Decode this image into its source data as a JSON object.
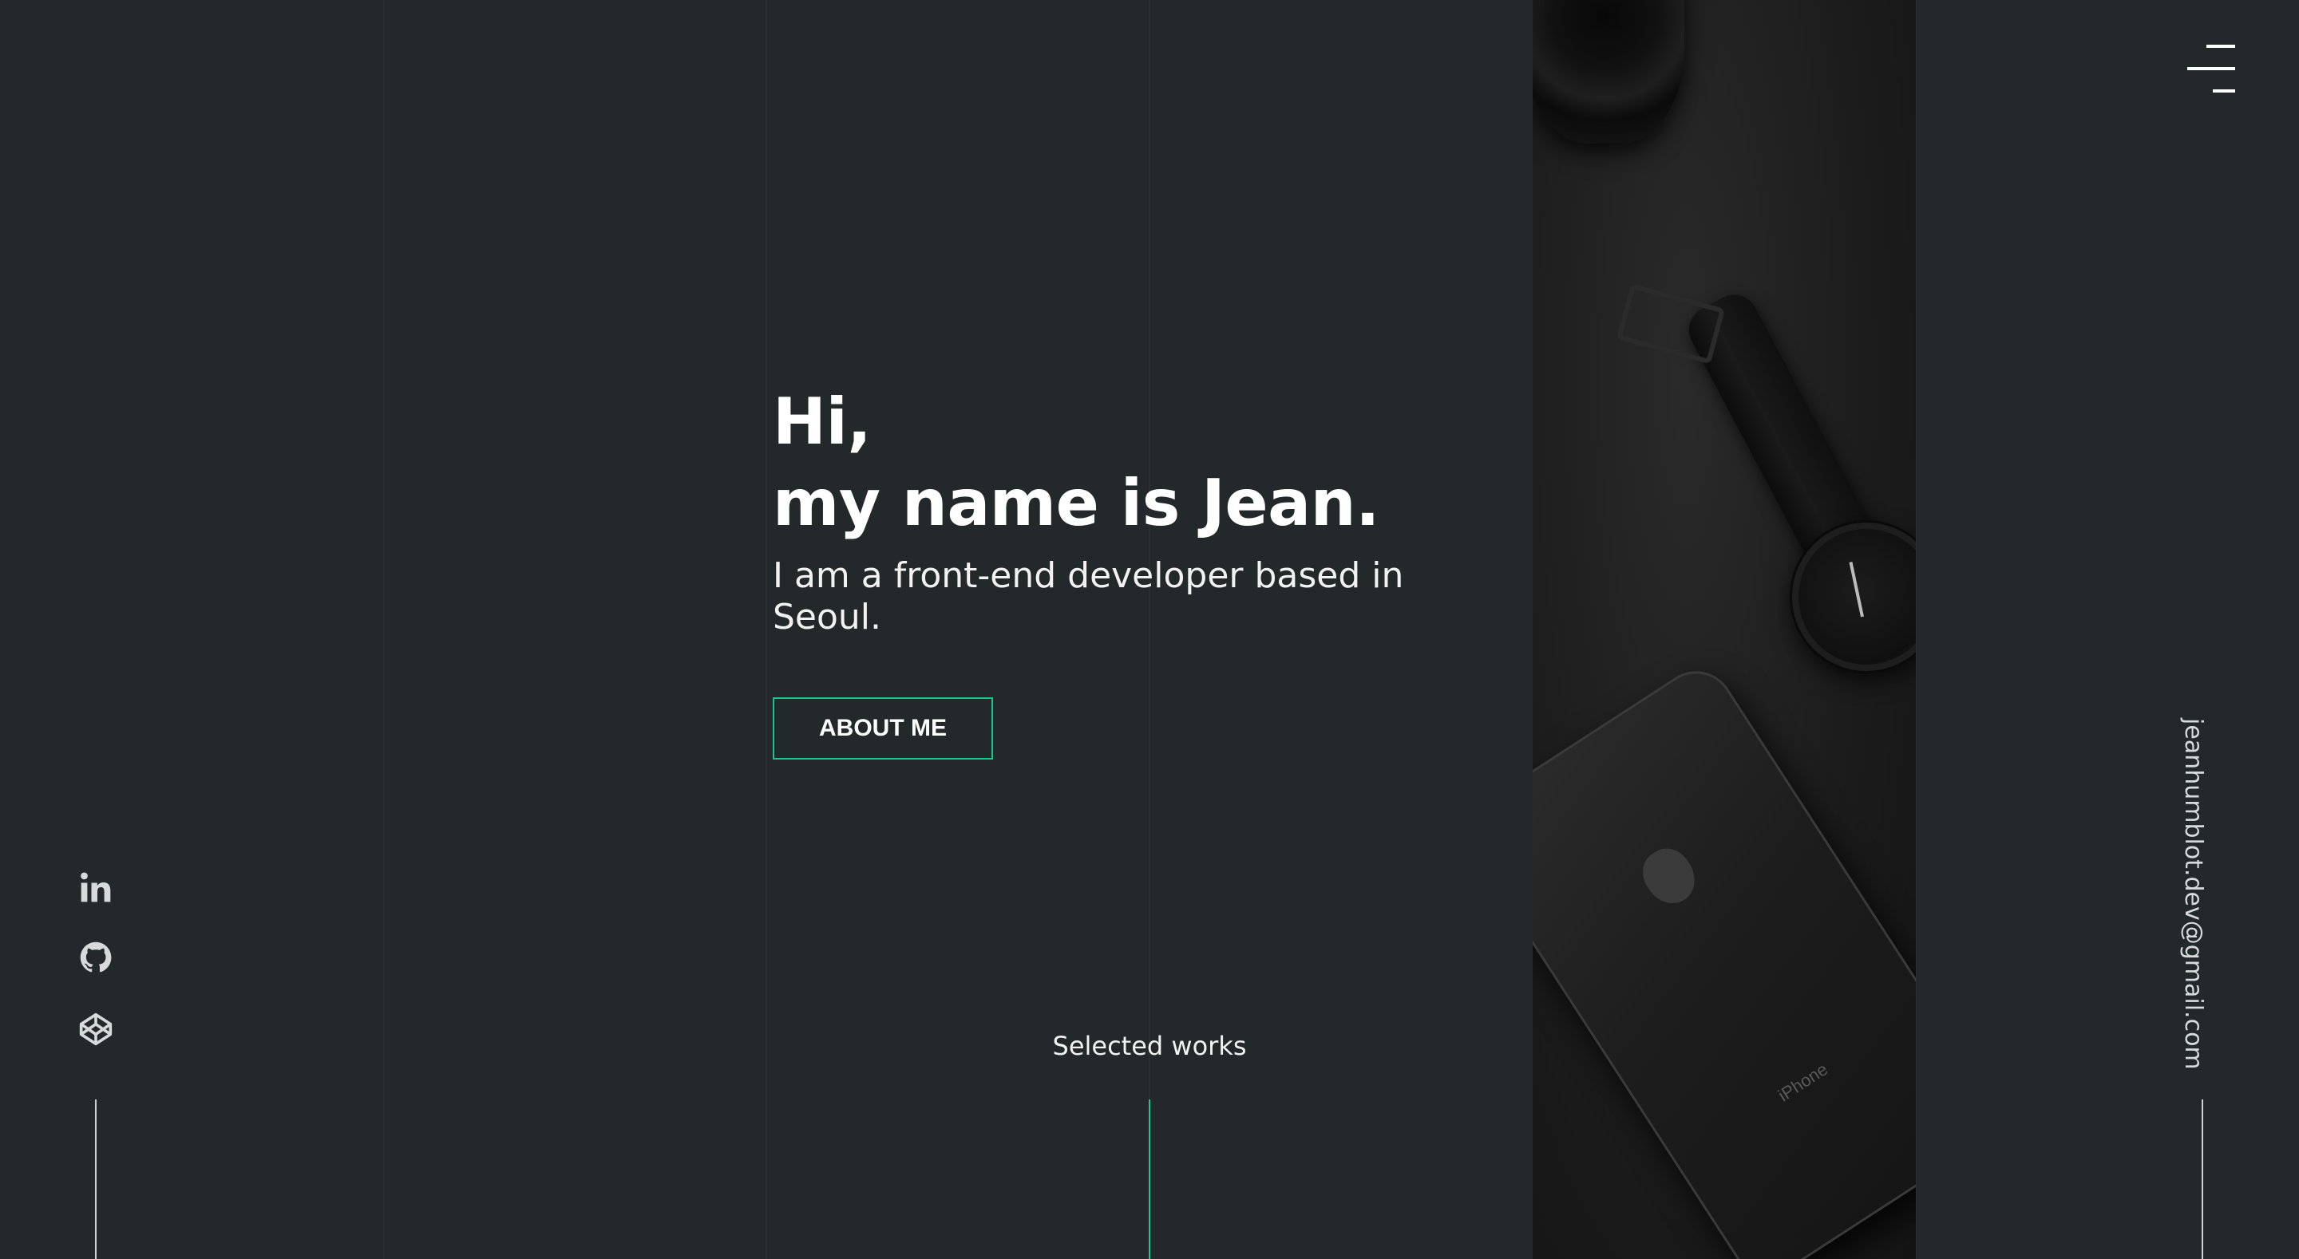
{
  "hero": {
    "greeting_line1": "Hi,",
    "greeting_line2": "my name is Jean.",
    "subtitle": "I am a front-end developer based in Seoul."
  },
  "buttons": {
    "about_label": "ABOUT ME"
  },
  "nav": {
    "menu_icon": "hamburger-menu-icon"
  },
  "social": [
    {
      "name": "linkedin-icon"
    },
    {
      "name": "github-icon"
    },
    {
      "name": "codepen-icon"
    }
  ],
  "footer": {
    "selected_works": "Selected works",
    "email": "jeanhumblot.dev@gmail.com"
  },
  "photo": {
    "phone_label": "iPhone"
  },
  "colors": {
    "background": "#23282b",
    "accent": "#1ec28b",
    "text": "#ffffff"
  }
}
